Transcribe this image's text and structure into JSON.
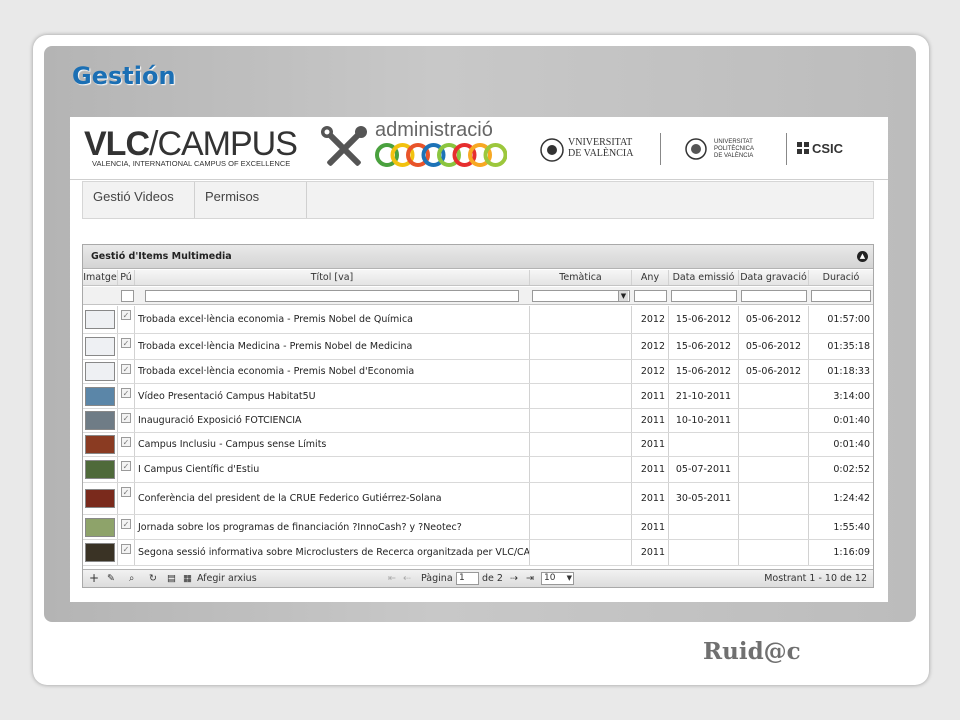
{
  "slide": {
    "title": "Gestión",
    "footer_logo": "Ruid@c"
  },
  "header": {
    "vlc_bold": "VLC",
    "vlc_rest": "/CAMPUS",
    "vlc_sub": "VALENCIA, INTERNATIONAL CAMPUS OF EXCELLENCE",
    "admin_label": "administració",
    "uv_line1": "VNIVERSITAT",
    "uv_line2": "DE VALÈNCIA",
    "upv_line1": "UNIVERSITAT",
    "upv_line2": "POLITÈCNICA",
    "upv_line3": "DE VALÈNCIA",
    "csic": "CSIC",
    "ring_colors": [
      "#4aa13e",
      "#f2c20f",
      "#e8542a",
      "#1d73b7",
      "#8bc53f",
      "#e62e2e",
      "#f7a823",
      "#9cc73c"
    ]
  },
  "nav": {
    "items": [
      {
        "label": "Gestió Videos"
      },
      {
        "label": "Permisos"
      }
    ]
  },
  "grid": {
    "title": "Gestió d'Items Multimedia",
    "columns": [
      "Imatge",
      "Pú",
      "Títol [va]",
      "Temàtica",
      "Any",
      "Data emissió",
      "Data gravació",
      "Duració"
    ],
    "rows": [
      {
        "title": "Trobada excel·lència economia - Premis Nobel de Química",
        "year": "2012",
        "emission": "15-06-2012",
        "recording": "05-06-2012",
        "duration": "01:57:00",
        "thumb": "#eef0f3"
      },
      {
        "title": "Trobada excel·lència Medicina - Premis Nobel de Medicina",
        "year": "2012",
        "emission": "15-06-2012",
        "recording": "05-06-2012",
        "duration": "01:35:18",
        "thumb": "#eef0f3"
      },
      {
        "title": "Trobada excel·lència economia - Premis Nobel d'Economia",
        "year": "2012",
        "emission": "15-06-2012",
        "recording": "05-06-2012",
        "duration": "01:18:33",
        "thumb": "#eef0f3"
      },
      {
        "title": "Vídeo Presentació Campus Habitat5U",
        "year": "2011",
        "emission": "21-10-2011",
        "recording": "",
        "duration": "3:14:00",
        "thumb": "#5b86a8"
      },
      {
        "title": "Inauguració Exposició FOTCIENCIA",
        "year": "2011",
        "emission": "10-10-2011",
        "recording": "",
        "duration": "0:01:40",
        "thumb": "#6f7c86"
      },
      {
        "title": "Campus Inclusiu - Campus sense Límits",
        "year": "2011",
        "emission": "",
        "recording": "",
        "duration": "0:01:40",
        "thumb": "#8a3b22"
      },
      {
        "title": "I Campus Científic d'Estiu",
        "year": "2011",
        "emission": "05-07-2011",
        "recording": "",
        "duration": "0:02:52",
        "thumb": "#4f6a3a"
      },
      {
        "title": "Conferència del president de la CRUE Federico Gutiérrez-Solana",
        "year": "2011",
        "emission": "30-05-2011",
        "recording": "",
        "duration": "1:24:42",
        "thumb": "#7a2a1c"
      },
      {
        "title": "Jornada sobre los programas de financiación ?InnoCash? y ?Neotec?",
        "year": "2011",
        "emission": "",
        "recording": "",
        "duration": "1:55:40",
        "thumb": "#8ea36a"
      },
      {
        "title": "Segona sessió informativa sobre Microclusters de Recerca organitzada per VLC/CA",
        "year": "2011",
        "emission": "",
        "recording": "",
        "duration": "1:16:09",
        "thumb": "#3a3325"
      }
    ]
  },
  "pager": {
    "attach_label": "Afegir arxius",
    "page_label": "Pàgina",
    "page_value": "1",
    "of_label": "de 2",
    "page_size": "10",
    "status": "Mostrant 1 - 10 de 12"
  }
}
